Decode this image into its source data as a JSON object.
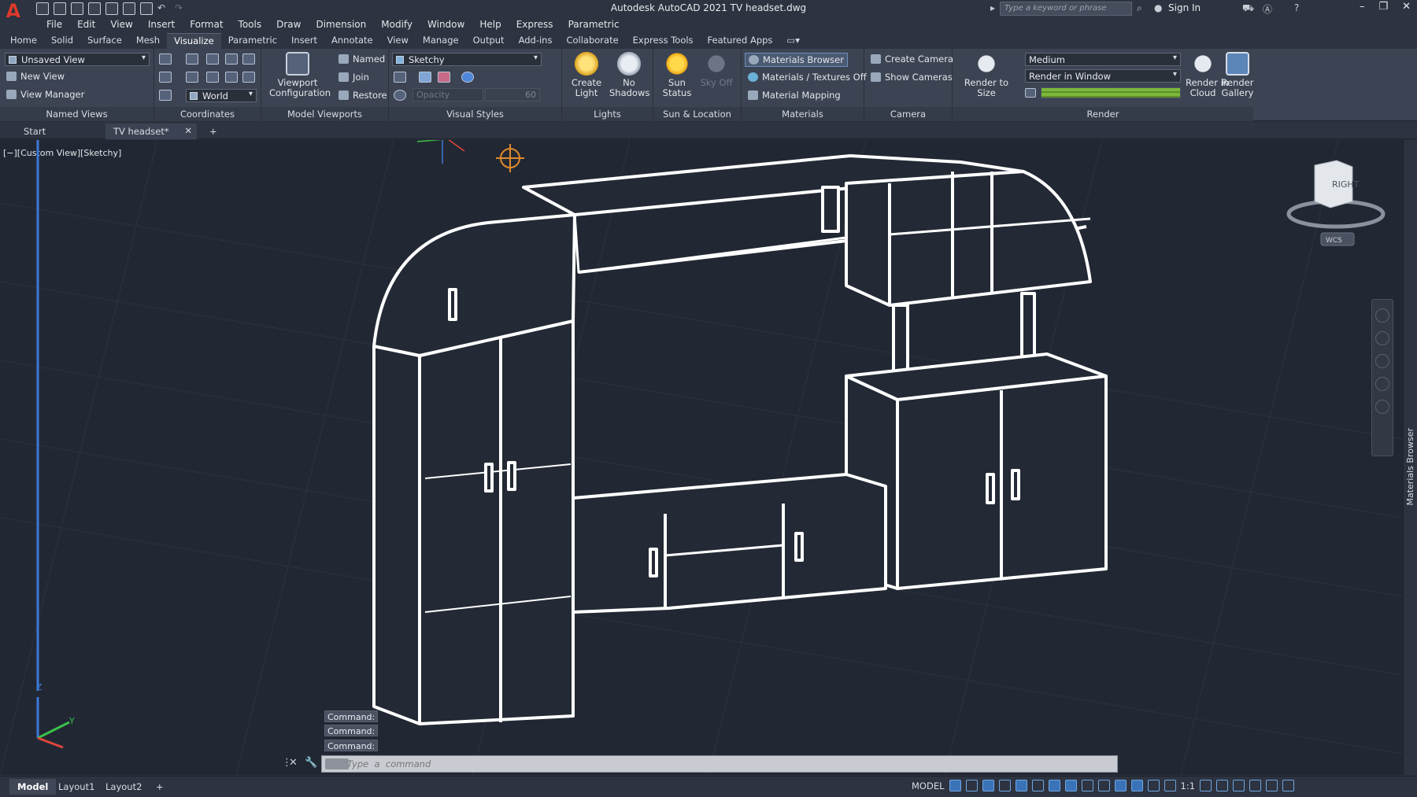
{
  "app": {
    "title": "Autodesk AutoCAD 2021   TV headset.dwg",
    "search_placeholder": "Type a keyword or phrase",
    "sign_in": "Sign In",
    "logo": "A",
    "accent_color": "#e23a2c"
  },
  "menu": [
    "File",
    "Edit",
    "View",
    "Insert",
    "Format",
    "Tools",
    "Draw",
    "Dimension",
    "Modify",
    "Window",
    "Help",
    "Express",
    "Parametric"
  ],
  "ribbon_tabs": [
    "Home",
    "Solid",
    "Surface",
    "Mesh",
    "Visualize",
    "Parametric",
    "Insert",
    "Annotate",
    "View",
    "Manage",
    "Output",
    "Add-ins",
    "Collaborate",
    "Express Tools",
    "Featured Apps"
  ],
  "active_tab": "Visualize",
  "panels": {
    "named_views": {
      "title": "Named Views",
      "view_combo": "Unsaved View",
      "new_view": "New View",
      "view_manager": "View Manager"
    },
    "coordinates": {
      "title": "Coordinates",
      "ucs_combo": "World"
    },
    "model_viewports": {
      "title": "Model Viewports",
      "viewport_config": "Viewport\nConfiguration",
      "named": "Named",
      "join": "Join",
      "restore": "Restore"
    },
    "visual_styles": {
      "title": "Visual Styles",
      "style_combo": "Sketchy",
      "opacity_placeholder": "Opacity",
      "opacity_value": "60"
    },
    "lights": {
      "title": "Lights",
      "create_light": "Create\nLight",
      "no_shadows": "No\nShadows"
    },
    "sun_location": {
      "title": "Sun & Location",
      "sun_status": "Sun\nStatus",
      "sky_off": "Sky Off"
    },
    "materials": {
      "title": "Materials",
      "browser": "Materials Browser",
      "textures": "Materials / Textures Off",
      "mapping": "Material Mapping"
    },
    "camera": {
      "title": "Camera",
      "create": "Create Camera",
      "show": "Show  Cameras"
    },
    "render": {
      "title": "Render",
      "render_to_size": "Render to Size",
      "quality": "Medium",
      "render_in": "Render in Window",
      "render_cloud": "Render in\nCloud",
      "render_gallery": "Render\nGallery",
      "progress": 1.0,
      "progress_color": "#7cb83a"
    }
  },
  "doc_tabs": {
    "start": "Start",
    "current": "TV headset*"
  },
  "viewport": {
    "label": "[−][Custom View][Sketchy]",
    "viewcube_face": "RIGHT",
    "wcs": "WCS",
    "axis_z": "Z",
    "axis_y": "Y"
  },
  "command": {
    "history": [
      "Command:",
      "Command:",
      "Command:"
    ],
    "placeholder": "Type  a  command"
  },
  "status": {
    "layouts": [
      "Model",
      "Layout1",
      "Layout2"
    ],
    "space": "MODEL",
    "scale": "1:1"
  },
  "side_palette": "Materials Browser"
}
